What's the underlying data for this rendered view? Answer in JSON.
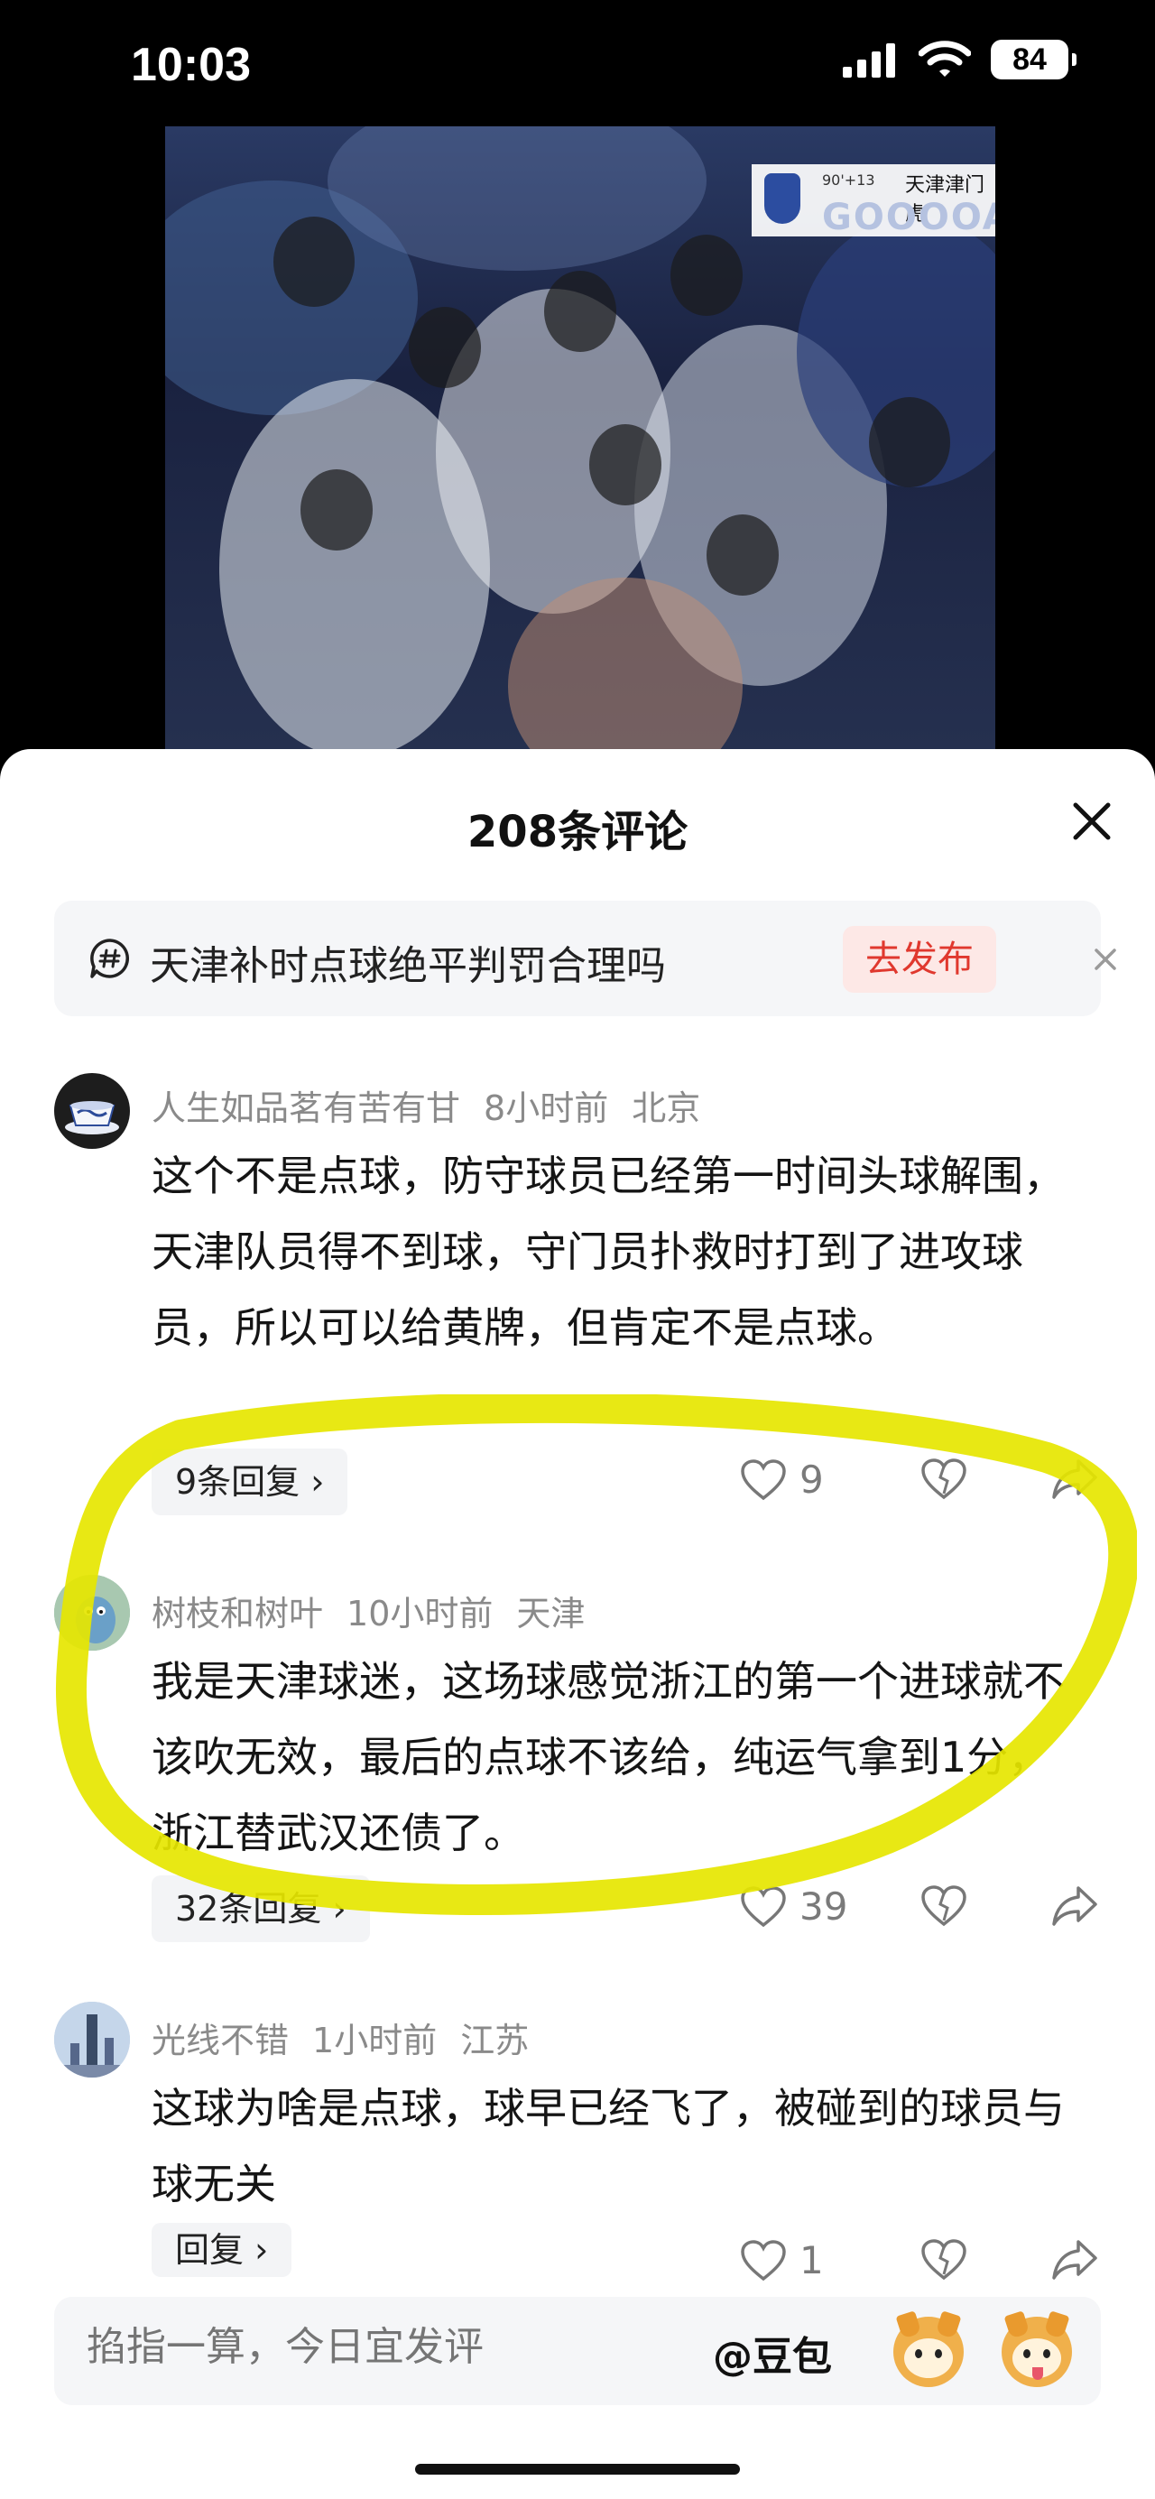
{
  "status": {
    "time": "10:03",
    "battery": "84"
  },
  "video": {
    "score_time": "90'+13",
    "score_team": "天津津门虎",
    "score_banner": "GOOOOAL"
  },
  "sheet": {
    "title": "208条评论"
  },
  "topic": {
    "text": "天津补时点球绝平判罚合理吗",
    "publish_label": "去发布"
  },
  "comments": [
    {
      "user": "人生如品茗有苦有甘",
      "time": "8小时前",
      "location": "北京",
      "text": "这个不是点球，防守球员已经第一时间头球解围，天津队员得不到球，守门员扑救时打到了进攻球员，所以可以给黄牌，但肯定不是点球。",
      "replies": "9条回复",
      "likes": "9"
    },
    {
      "user": "树枝和树叶",
      "time": "10小时前",
      "location": "天津",
      "text": "我是天津球迷，这场球感觉浙江的第一个进球就不该吹无效，最后的点球不该给，纯运气拿到1分，浙江替武汉还债了。",
      "replies": "32条回复",
      "likes": "39"
    },
    {
      "user": "光线不错",
      "time": "1小时前",
      "location": "江苏",
      "text": "这球为啥是点球，球早已经飞了，被碰到的球员与球无关",
      "replies": "回复",
      "likes": "1"
    }
  ],
  "input": {
    "placeholder": "掐指一算，今日宜发评",
    "mention": "@豆包"
  },
  "colors": {
    "highlight": "#e6e600",
    "publish_red": "#e0382e",
    "publish_bg": "#fde8e6"
  },
  "icons": [
    "signal-icon",
    "wifi-icon",
    "battery-icon",
    "close-icon",
    "topic-hash-icon",
    "dismiss-icon",
    "like-icon",
    "dislike-icon",
    "share-icon",
    "emoji-shiba-icon"
  ]
}
